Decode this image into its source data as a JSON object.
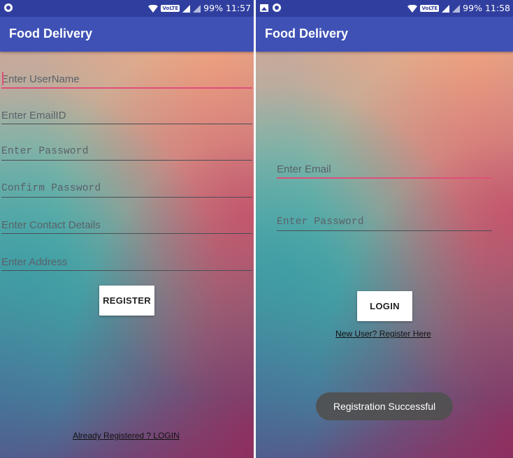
{
  "screens": [
    {
      "status_bar": {
        "battery": "99%",
        "time": "11:57",
        "lte": "VoLTE"
      },
      "app_bar": {
        "title": "Food Delivery"
      },
      "form": {
        "username_placeholder": "Enter UserName",
        "email_placeholder": "Enter EmailID",
        "password_placeholder": "Enter Password",
        "confirm_placeholder": "Confirm Password",
        "contact_placeholder": "Enter Contact Details",
        "address_placeholder": "Enter Address"
      },
      "register_button": "REGISTER",
      "login_link": "Already Registered ? LOGIN"
    },
    {
      "status_bar": {
        "battery": "99%",
        "time": "11:58",
        "lte": "VoLTE"
      },
      "app_bar": {
        "title": "Food Delivery"
      },
      "form": {
        "email_placeholder": "Enter Email",
        "password_placeholder": "Enter Password"
      },
      "login_button": "LOGIN",
      "register_link": "New User? Register Here",
      "toast": "Registration Successful"
    }
  ],
  "colors": {
    "status_bar": "#303f9f",
    "app_bar": "#3f51b5",
    "accent": "#e04e7a"
  },
  "icons": [
    "notification-dot-icon",
    "gallery-icon",
    "wifi-icon",
    "lte-icon",
    "signal-icon",
    "battery-icon"
  ]
}
